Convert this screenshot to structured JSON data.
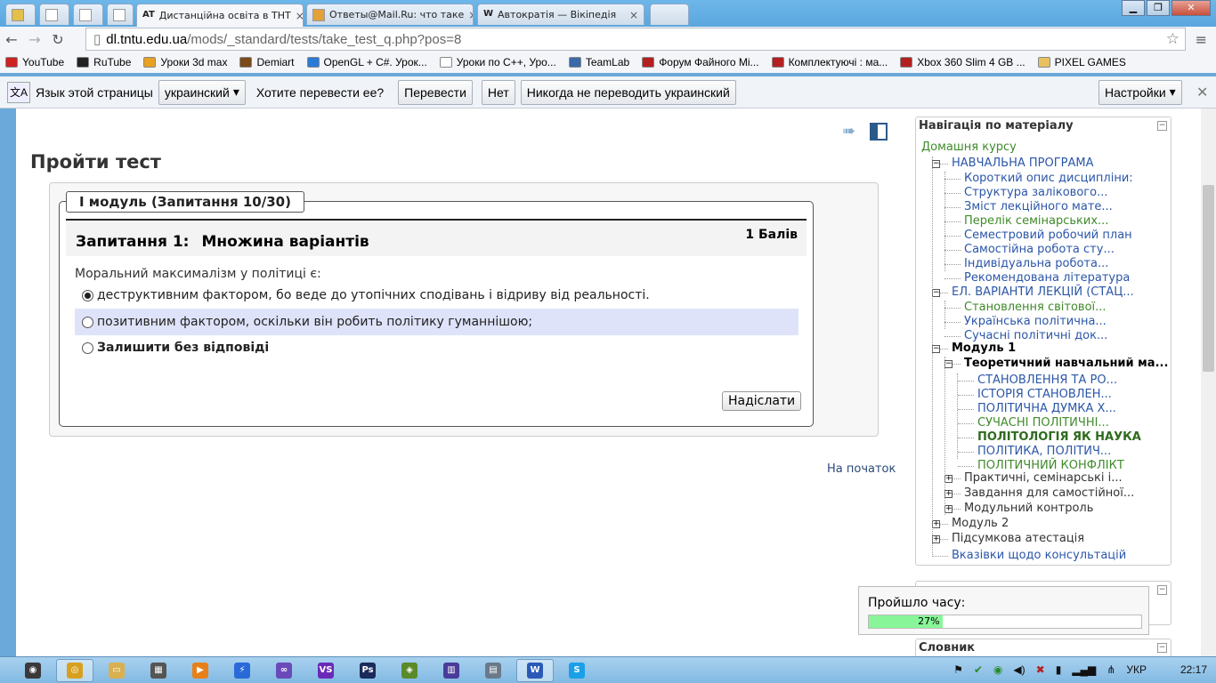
{
  "browser": {
    "tabs": [
      {
        "label": "",
        "fav_color": "#e4c04a"
      },
      {
        "label": "",
        "fav_color": "#ffffff"
      },
      {
        "label": "",
        "fav_color": "#ffffff"
      },
      {
        "label": "",
        "fav_color": "#ffffff"
      },
      {
        "label": "Дистанційна освіта в ТНТ",
        "fav_text": "AT",
        "active": true
      },
      {
        "label": "Ответы@Mail.Ru: что таке",
        "fav_color": "#e4a13a"
      },
      {
        "label": "Автократія — Вікіпедія",
        "fav_text": "W"
      }
    ],
    "url_host": "dl.tntu.edu.ua",
    "url_path": "/mods/_standard/tests/take_test_q.php?pos=8",
    "bookmarks": [
      {
        "label": "YouTube",
        "color": "#cc2222"
      },
      {
        "label": "RuTube",
        "color": "#222222"
      },
      {
        "label": "Уроки 3d max",
        "color": "#e8a020"
      },
      {
        "label": "Demiart",
        "color": "#7a4a1a"
      },
      {
        "label": "OpenGL + C#. Урок...",
        "color": "#2a7ad8"
      },
      {
        "label": "Уроки по C++, Уро...",
        "color": "#ffffff"
      },
      {
        "label": "TeamLab",
        "color": "#3a6aa8"
      },
      {
        "label": "Форум Файного Мі...",
        "color": "#b42020"
      },
      {
        "label": "Комплектуючі : ма...",
        "color": "#b42020"
      },
      {
        "label": "Xbox 360 Slim 4 GB ...",
        "color": "#b42020"
      },
      {
        "label": "PIXEL GAMES",
        "color": "#e8c060"
      }
    ]
  },
  "translate_bar": {
    "prompt": "Язык этой страницы",
    "language": "украинский",
    "question": "Хотите перевести ее?",
    "translate_label": "Перевести",
    "no_label": "Нет",
    "never_label": "Никогда не переводить украинский",
    "settings_label": "Настройки"
  },
  "page": {
    "title": "Пройти тест",
    "legend": "I модуль (Запитання 10/30)",
    "question_number": "Запитання 1:",
    "question_type": "Множина варіантів",
    "grade": "1 Балів",
    "question_text": "Моральний максималізм у політиці є:",
    "answers": [
      {
        "label": "деструктивним фактором, бо веде до утопічних сподівань і відриву від реальності.",
        "selected": true
      },
      {
        "label": "позитивним фактором, оскільки він робить політику гуманнішою;",
        "selected": false
      },
      {
        "label": "Залишити без відповіді",
        "selected": false
      }
    ],
    "submit_label": "Надіслати",
    "to_top_label": "На початок"
  },
  "sidebar": {
    "nav_title": "Навігація по матеріалу",
    "home": "Домашня курсу",
    "items": [
      {
        "label": "НАВЧАЛЬНА ПРОГРАМА",
        "style": "link"
      },
      {
        "label": "Короткий опис дисципліни:",
        "style": "link"
      },
      {
        "label": "Структура залікового...",
        "style": "link"
      },
      {
        "label": "Зміст лекційного мате...",
        "style": "link"
      },
      {
        "label": "Перелік семінарських...",
        "style": "green"
      },
      {
        "label": "Семестровий робочий план",
        "style": "link"
      },
      {
        "label": "Самостійна робота сту...",
        "style": "link"
      },
      {
        "label": "Індивідуальна робота...",
        "style": "link"
      },
      {
        "label": "Рекомендована література",
        "style": "link"
      },
      {
        "label": "ЕЛ. ВАРІАНТИ ЛЕКЦІЙ (СТАЦ...",
        "style": "link"
      },
      {
        "label": "Становлення світової...",
        "style": "green"
      },
      {
        "label": "Українська політична...",
        "style": "link"
      },
      {
        "label": "Сучасні політичні док...",
        "style": "link"
      },
      {
        "label": "Модуль 1",
        "style": "bold"
      },
      {
        "label": "Теоретичний навчальний ма...",
        "style": "bold"
      },
      {
        "label": "СТАНОВЛЕННЯ ТА РО...",
        "style": "link"
      },
      {
        "label": "ІСТОРІЯ СТАНОВЛЕН...",
        "style": "link"
      },
      {
        "label": "ПОЛІТИЧНА ДУМКА Х...",
        "style": "link"
      },
      {
        "label": "СУЧАСНІ ПОЛІТИЧНІ...",
        "style": "green"
      },
      {
        "label": "ПОЛІТОЛОГІЯ ЯК НАУКА",
        "style": "current"
      },
      {
        "label": "ПОЛІТИКА, ПОЛІТИЧ...",
        "style": "link"
      },
      {
        "label": "ПОЛІТИЧНИЙ КОНФЛІКТ",
        "style": "green"
      },
      {
        "label": "Практичні, семінарські і...",
        "style": "dark"
      },
      {
        "label": "Завдання для самостійної...",
        "style": "dark"
      },
      {
        "label": "Модульний контроль",
        "style": "dark"
      },
      {
        "label": "Модуль 2",
        "style": "dark"
      },
      {
        "label": "Підсумкова атестація",
        "style": "dark"
      },
      {
        "label": "Вказівки щодо консультацій",
        "style": "link"
      }
    ],
    "timer_label": "Пройшло часу:",
    "timer_percent": "27%",
    "timer_fraction": 0.27,
    "dictionary_title": "Словник"
  },
  "taskbar": {
    "items": [
      {
        "icon": "windows-start-icon",
        "color": "#3a3a3a",
        "text": "◉"
      },
      {
        "icon": "chrome-icon",
        "color": "#d8a020",
        "text": "◎",
        "active": true
      },
      {
        "icon": "explorer-icon",
        "color": "#d8b050",
        "text": "▭"
      },
      {
        "icon": "media-icon",
        "color": "#555555",
        "text": "▦"
      },
      {
        "icon": "player-icon",
        "color": "#e8801a",
        "text": "▶"
      },
      {
        "icon": "bolt-icon",
        "color": "#2a6ad8",
        "text": "⚡"
      },
      {
        "icon": "link-icon",
        "color": "#6a4ab8",
        "text": "∞"
      },
      {
        "icon": "visual-studio-icon",
        "color": "#6a2ab8",
        "text": "VS"
      },
      {
        "icon": "photoshop-icon",
        "color": "#1a2a5a",
        "text": "Ps"
      },
      {
        "icon": "game-icon",
        "color": "#5a8a2a",
        "text": "◈"
      },
      {
        "icon": "stack-icon",
        "color": "#4a3a9a",
        "text": "▥"
      },
      {
        "icon": "calculator-icon",
        "color": "#6a7a8a",
        "text": "▤"
      },
      {
        "icon": "word-icon",
        "color": "#2a5ab8",
        "text": "W",
        "active": true
      },
      {
        "icon": "skype-icon",
        "color": "#1aa0e8",
        "text": "S"
      }
    ],
    "language": "УКР",
    "time": "22:17"
  }
}
